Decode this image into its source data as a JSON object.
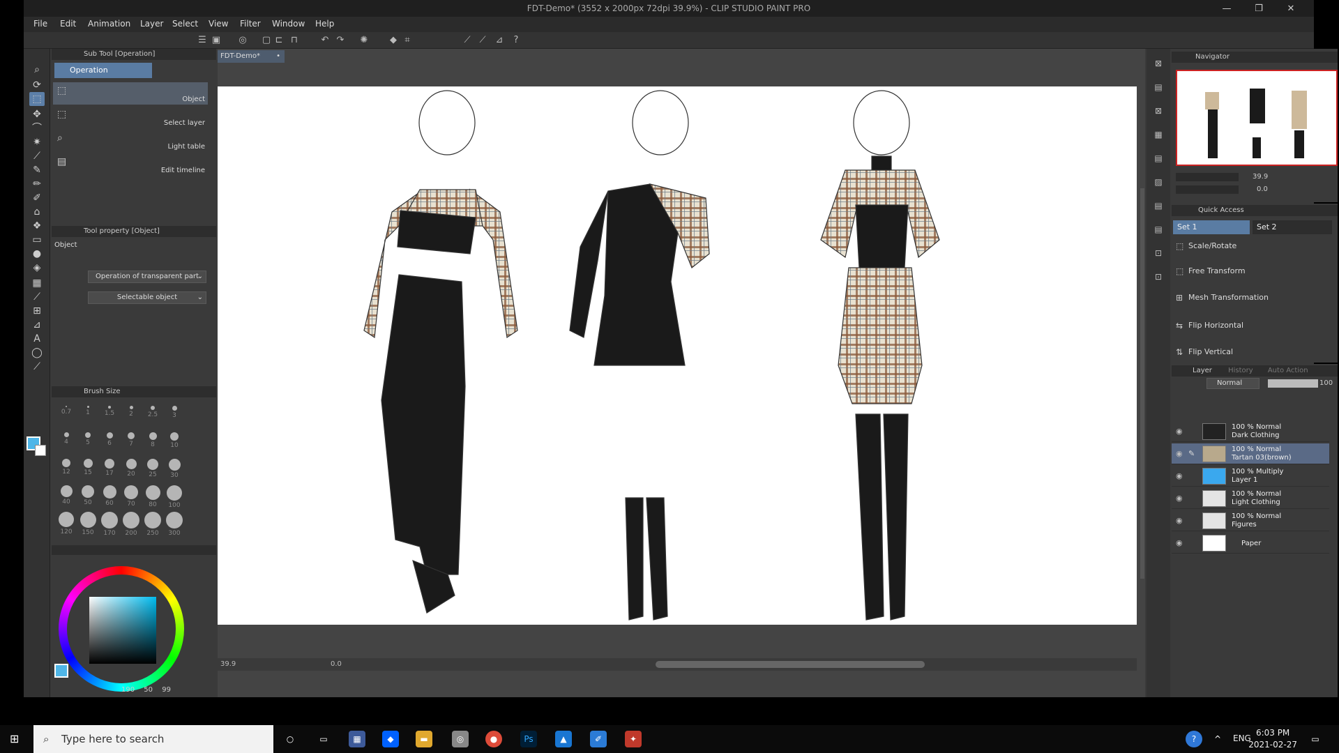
{
  "window": {
    "title": "FDT-Demo* (3552 x 2000px 72dpi 39.9%) - CLIP STUDIO PAINT PRO",
    "minimize": "—",
    "restore": "❐",
    "close": "✕"
  },
  "menu": [
    "File",
    "Edit",
    "Animation",
    "Layer",
    "Select",
    "View",
    "Filter",
    "Window",
    "Help"
  ],
  "sub_tool": {
    "panel_title": "Sub Tool [Operation]",
    "group_tab": "Operation",
    "items": [
      {
        "label": "Object",
        "icon": "object-icon"
      },
      {
        "label": "Select layer",
        "icon": "select-layer-icon"
      },
      {
        "label": "Light table",
        "icon": "light-table-icon"
      },
      {
        "label": "Edit timeline",
        "icon": "edit-timeline-icon"
      }
    ]
  },
  "tool_property": {
    "panel_title": "Tool property [Object]",
    "section": "Object",
    "dropdown1": "Operation of transparent part",
    "dropdown2": "Selectable object"
  },
  "brush_size": {
    "panel_title": "Brush Size",
    "sizes": [
      "0.7",
      "1",
      "1.5",
      "2",
      "2.5",
      "3",
      "4",
      "5",
      "6",
      "7",
      "8",
      "10",
      "12",
      "15",
      "17",
      "20",
      "25",
      "30",
      "40",
      "50",
      "60",
      "70",
      "80",
      "100",
      "120",
      "150",
      "170",
      "200",
      "250",
      "300"
    ]
  },
  "color": {
    "h": "190",
    "s": "50",
    "v": "99",
    "main_color": "#4fb6e8",
    "sub_color": "#ffffff"
  },
  "canvas": {
    "doc_tab": "FDT-Demo*",
    "zoom": "39.9",
    "rotation": "0.0"
  },
  "navigator": {
    "title": "Navigator",
    "zoom": "39.9",
    "rotation": "0.0"
  },
  "quick_access": {
    "title": "Quick Access",
    "tabs": [
      "Set 1",
      "Set 2"
    ],
    "items": [
      {
        "label": "Scale/Rotate",
        "icon": "scale-rotate-icon"
      },
      {
        "label": "Free Transform",
        "icon": "free-transform-icon"
      },
      {
        "label": "Mesh Transformation",
        "icon": "mesh-transformation-icon"
      },
      {
        "label": "Flip Horizontal",
        "icon": "flip-horizontal-icon"
      },
      {
        "label": "Flip Vertical",
        "icon": "flip-vertical-icon"
      }
    ]
  },
  "layers": {
    "title": "Layer",
    "tab2": "History",
    "tab3": "Auto Action",
    "blend_mode": "Normal",
    "opacity": "100",
    "rows": [
      {
        "line1": "100 % Normal",
        "line2": "Dark Clothing"
      },
      {
        "line1": "100 % Normal",
        "line2": "Tartan 03(brown)"
      },
      {
        "line1": "100 % Multiply",
        "line2": "Layer 1"
      },
      {
        "line1": "100 % Normal",
        "line2": "Light Clothing"
      },
      {
        "line1": "100 % Normal",
        "line2": "Figures"
      },
      {
        "line1": "",
        "line2": "Paper"
      }
    ]
  },
  "taskbar": {
    "search_placeholder": "Type here to search",
    "lang": "ENG",
    "time": "6:03 PM",
    "date": "2021-02-27"
  },
  "colors": {
    "accent": "#5a7ca3",
    "selection": "#5a6a86",
    "navigator_frame": "#cc2222"
  }
}
